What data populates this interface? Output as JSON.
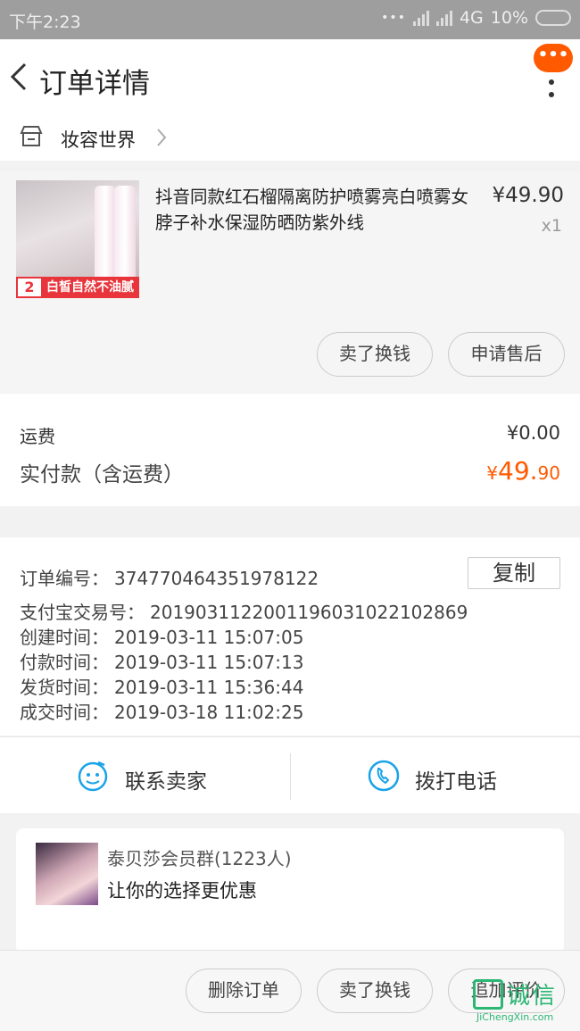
{
  "status_bar": {
    "time": "下午2:23",
    "network": "4G",
    "battery": "10%"
  },
  "nav": {
    "title": "订单详情"
  },
  "shop": {
    "name": "妆容世界"
  },
  "product": {
    "thumb_badge_num": "2",
    "thumb_badge_text": "白皙自然不油腻",
    "title": "抖音同款红石榴隔离防护喷雾亮白喷雾女脖子补水保湿防晒防紫外线",
    "price": "¥49.90",
    "quantity": "x1",
    "actions": [
      "卖了换钱",
      "申请售后"
    ]
  },
  "fees": {
    "shipping_label": "运费",
    "shipping_value": "¥0.00",
    "paid_label": "实付款（含运费）",
    "paid_currency": "¥",
    "paid_integer": "49.",
    "paid_decimal": "90"
  },
  "order_info": {
    "copy_label": "复制",
    "rows": [
      {
        "label": "订单编号：",
        "value": "374770464351978122"
      },
      {
        "label": "支付宝交易号：",
        "value": "2019031122001196031022102869"
      },
      {
        "label": "创建时间：",
        "value": "2019-03-11 15:07:05"
      },
      {
        "label": "付款时间：",
        "value": "2019-03-11 15:07:13"
      },
      {
        "label": "发货时间：",
        "value": "2019-03-11 15:36:44"
      },
      {
        "label": "成交时间：",
        "value": "2019-03-18 11:02:25"
      }
    ]
  },
  "contact": {
    "seller_label": "联系卖家",
    "call_label": "拨打电话"
  },
  "promo": {
    "group": "泰贝莎会员群(1223人)",
    "slogan": "让你的选择更优惠"
  },
  "footer": {
    "actions": [
      "删除订单",
      "卖了换钱",
      "追加评价"
    ]
  },
  "watermark": {
    "cn": "诚信",
    "en": "JiChengXin.com"
  },
  "colors": {
    "accent": "#ff5a00",
    "icon_blue": "#1aa3e8",
    "watermark": "#2bb673"
  }
}
